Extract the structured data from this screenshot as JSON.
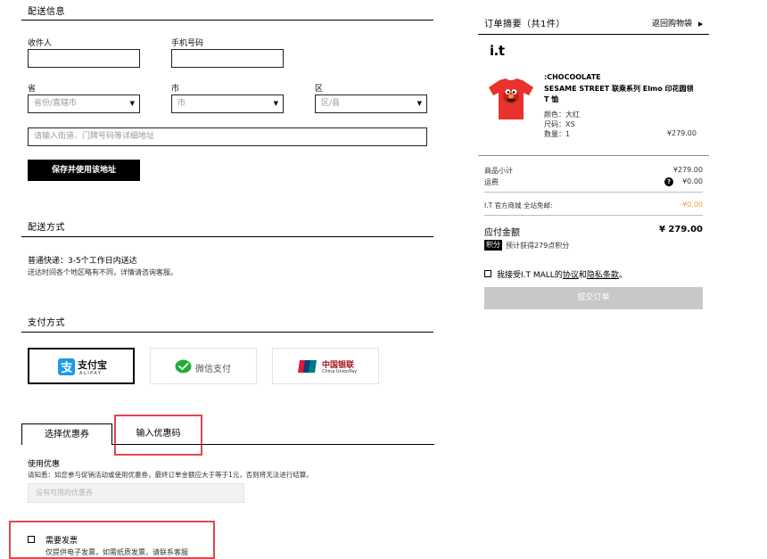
{
  "delivery_info": {
    "title": "配送信息",
    "recipient_label": "收件人",
    "phone_label": "手机号码",
    "province_label": "省",
    "city_label": "市",
    "district_label": "区",
    "province_placeholder": "省份/直辖市",
    "city_placeholder": "市",
    "district_placeholder": "区/县",
    "address_placeholder": "请输入街道、门牌号码等详细地址",
    "save_button": "保存并使用该地址"
  },
  "delivery_method": {
    "title": "配送方式",
    "option": "普通快递：3-5个工作日内送达",
    "note": "送达时间各个地区略有不同，详情请咨询客服。"
  },
  "payment": {
    "title": "支付方式",
    "alipay_cn": "支付宝",
    "alipay_en": "ALIPAY",
    "wechat": "微信支付",
    "unionpay_cn": "中国银联",
    "unionpay_en": "China UnionPay"
  },
  "coupon": {
    "tab_select": "选择优惠券",
    "tab_code": "输入优惠码",
    "use_title": "使用优惠",
    "notice": "请知悉：如您参与促销活动或使用优惠券，最终订单金额应大于等于1元，否则将无法进行结算。",
    "placeholder": "没有可用的优惠券"
  },
  "invoice": {
    "label": "需要发票",
    "note": "仅提供电子发票，如需纸质发票，请联系客服"
  },
  "summary": {
    "title": "订单摘要（共1件）",
    "back_link": "返回购物袋",
    "brand_logo": "i.t",
    "product_brand": ":CHOCOOLATE",
    "product_name": "SESAME STREET 联乘系列 Elmo 印花圆领 T 恤",
    "color": "颜色：大红",
    "size": "尺码：XS",
    "qty": "数量：1",
    "price": "¥279.00",
    "subtotal_label": "商品小计",
    "subtotal_value": "¥279.00",
    "shipping_label": "运费",
    "shipping_value": "¥0.00",
    "promo_label": "I.T 官方商城 全站免邮:",
    "promo_value": "-¥0.00",
    "total_label": "应付金额",
    "total_value": "¥ 279.00",
    "points_badge": "积分",
    "points_text": "预计获得279点积分",
    "agree_prefix": "我接受I.T MALL的",
    "agree_link1": "协议",
    "agree_and": "和",
    "agree_link2": "隐私条款",
    "agree_suffix": "。",
    "submit_button": "提交订单"
  },
  "colors": {
    "accent_red": "#e0484e",
    "promo_orange": "#e8a23c",
    "submit_gray": "#c8c8c8"
  }
}
